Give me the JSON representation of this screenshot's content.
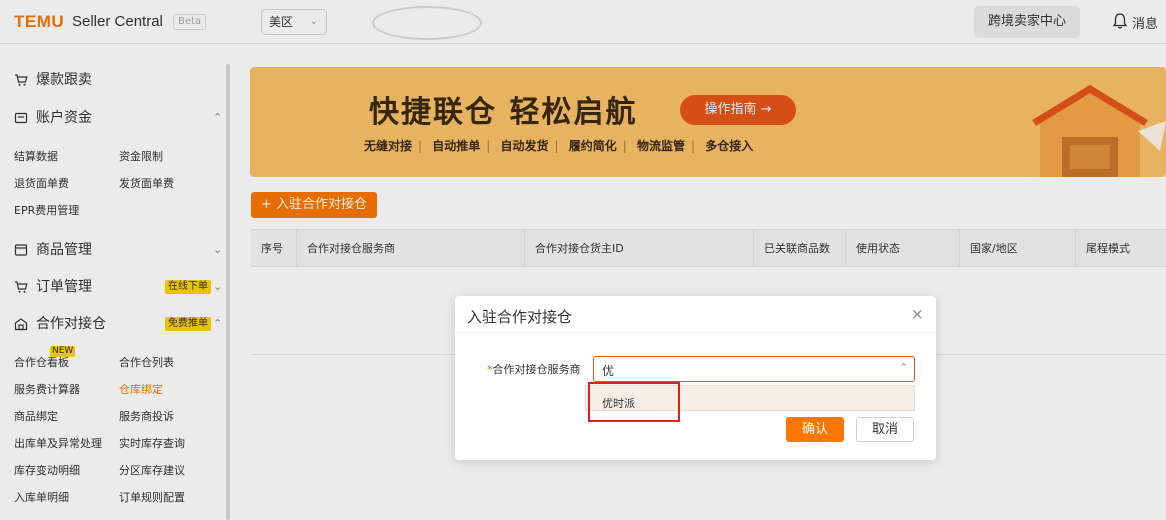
{
  "header": {
    "logo": "TEMU",
    "logo_sub": "Seller Central",
    "beta": "Beta",
    "region": "美区",
    "cross_border": "跨境卖家中心",
    "messages": "消息"
  },
  "sidebar": {
    "hot_sell": "爆款跟卖",
    "account_funds": "账户资金",
    "account_sub": [
      "结算数据",
      "资金限制",
      "退货面单费",
      "发货面单费",
      "EPR费用管理"
    ],
    "goods_mgmt": "商品管理",
    "order_mgmt": "订单管理",
    "order_badge": "在线下单",
    "coop_warehouse": "合作对接仓",
    "coop_badge": "免费推单",
    "new_tag": "NEW",
    "coop_sub": [
      "合作仓看板",
      "合作仓列表",
      "服务费计算器",
      "仓库绑定",
      "商品绑定",
      "服务商投诉",
      "出库单及异常处理",
      "实时库存查询",
      "库存变动明细",
      "分区库存建议",
      "入库单明细",
      "订单规则配置"
    ]
  },
  "banner": {
    "title": "快捷联仓 轻松启航",
    "guide_button": "操作指南 →",
    "features": [
      "无缝对接",
      "自动推单",
      "自动发货",
      "履约简化",
      "物流监管",
      "多仓接入"
    ]
  },
  "main": {
    "add_button": "+ 入驻合作对接仓",
    "columns": [
      "序号",
      "合作对接仓服务商",
      "合作对接仓货主ID",
      "已关联商品数",
      "使用状态",
      "国家/地区",
      "尾程模式"
    ]
  },
  "modal": {
    "title": "入驻合作对接仓",
    "close": "×",
    "field_label": "合作对接仓服务商",
    "required_mark": "*",
    "input_value": "优",
    "option": "优时派",
    "confirm": "确认",
    "cancel": "取消"
  },
  "colors": {
    "brand": "#fb7701",
    "badge": "#ffd400",
    "banner": "#fbc36a",
    "highlight": "#e02020"
  }
}
